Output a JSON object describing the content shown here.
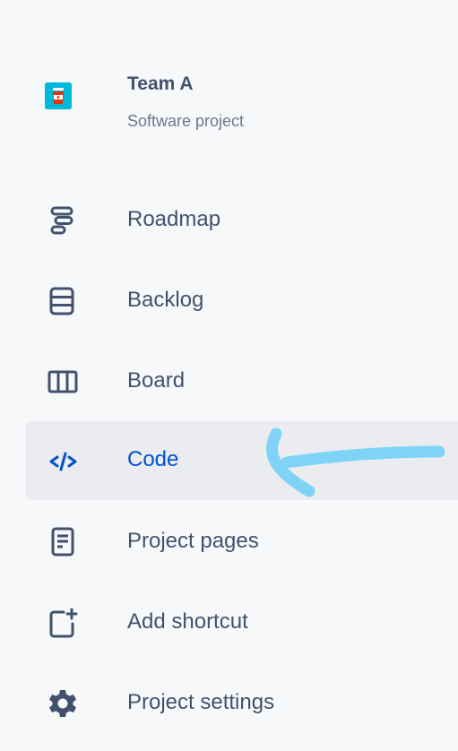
{
  "project": {
    "name": "Team A",
    "type": "Software project",
    "avatar_icon": "coffee-cup-icon",
    "avatar_color": "#00b8d9"
  },
  "nav": {
    "items": [
      {
        "label": "Roadmap",
        "icon": "roadmap-icon"
      },
      {
        "label": "Backlog",
        "icon": "backlog-icon"
      },
      {
        "label": "Board",
        "icon": "board-icon"
      },
      {
        "label": "Code",
        "icon": "code-icon",
        "selected": true
      },
      {
        "label": "Project pages",
        "icon": "page-icon"
      },
      {
        "label": "Add shortcut",
        "icon": "add-shortcut-icon"
      },
      {
        "label": "Project settings",
        "icon": "gear-icon"
      }
    ]
  },
  "colors": {
    "sidebar_bg": "#f7f8fa",
    "selected_bg": "#ebecf0",
    "text": "#42526e",
    "selected_text": "#0052cc",
    "annotation_arrow": "#7fd3f7"
  }
}
